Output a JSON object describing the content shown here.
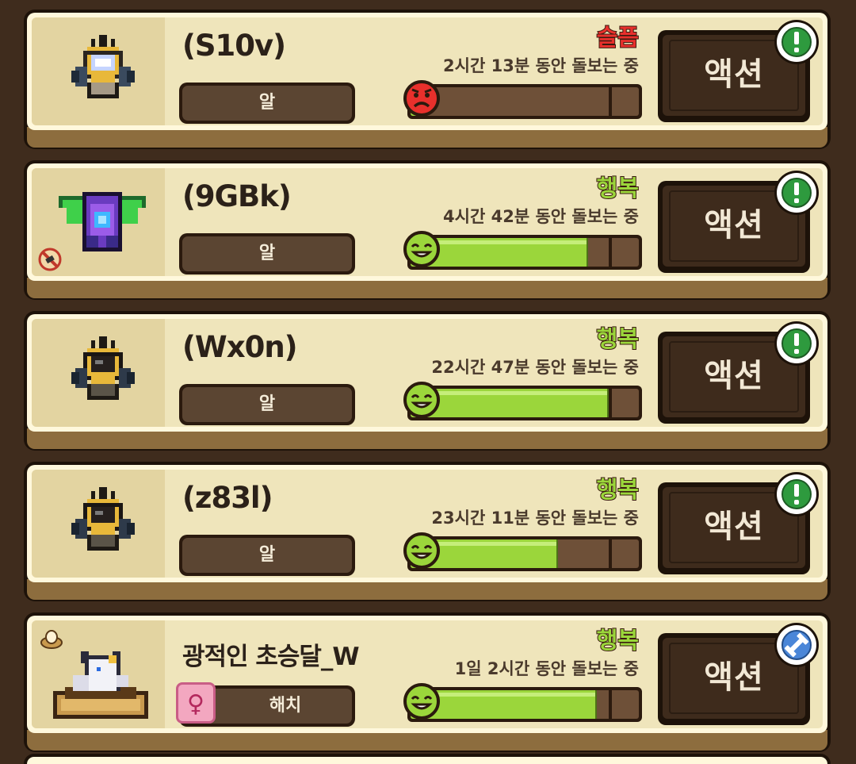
{
  "action_label": "액션",
  "pets": [
    {
      "name": "(S10v)",
      "type_label": "알",
      "mood_label": "슬픔",
      "mood_color": "#e8302c",
      "mood_face": "sad",
      "care_time": "2시간 13분 동안 돌보는 중",
      "happiness": 0.04,
      "sprite": "golden-orb-egg",
      "corner_badge": "exclamation-badge",
      "gender": null,
      "extra_badge": null
    },
    {
      "name": "(9GBk)",
      "type_label": "알",
      "mood_label": "행복",
      "mood_color": "#9bd63b",
      "mood_face": "happy",
      "care_time": "4시간 42분 동안 돌보는 중",
      "happiness": 0.77,
      "sprite": "purple-winged-egg",
      "corner_badge": "exclamation-badge",
      "gender": null,
      "extra_badge": "no-entry-badge"
    },
    {
      "name": "(Wx0n)",
      "type_label": "알",
      "mood_label": "행복",
      "mood_color": "#9bd63b",
      "mood_face": "happy",
      "care_time": "22시간 47분 동안 돌보는 중",
      "happiness": 0.86,
      "sprite": "dark-orb-egg",
      "corner_badge": "exclamation-badge",
      "gender": null,
      "extra_badge": null
    },
    {
      "name": "(z83l)",
      "type_label": "알",
      "mood_label": "행복",
      "mood_color": "#9bd63b",
      "mood_face": "happy",
      "care_time": "23시간 11분 동안 돌보는 중",
      "happiness": 0.64,
      "sprite": "dark-orb-egg",
      "corner_badge": "exclamation-badge",
      "gender": null,
      "extra_badge": null
    },
    {
      "name": "광적인 초승달_W",
      "type_label": "해치",
      "mood_label": "행복",
      "mood_color": "#9bd63b",
      "mood_face": "happy",
      "care_time": "1일 2시간 동안 돌보는 중",
      "happiness": 0.81,
      "sprite": "white-pet-in-nest",
      "corner_badge": "dumbbell-badge",
      "gender": "♀",
      "extra_badge": "nest-egg-badge"
    }
  ]
}
